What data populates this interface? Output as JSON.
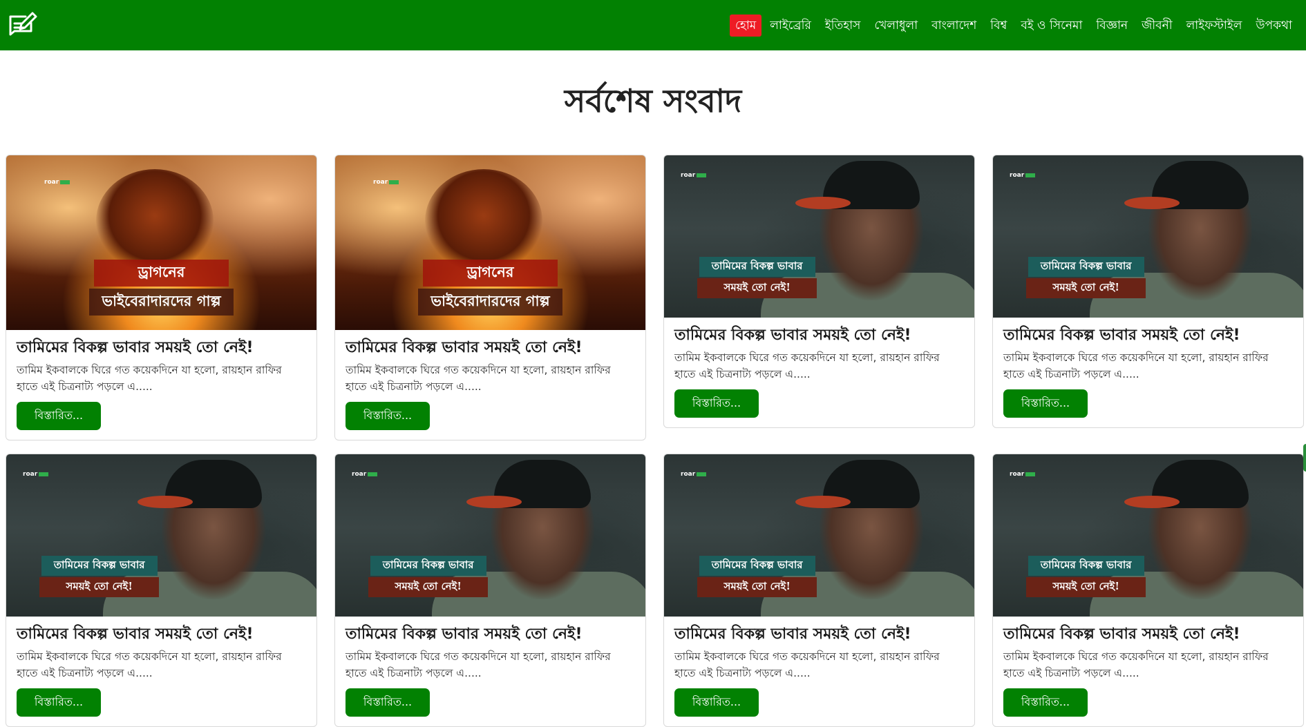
{
  "header": {
    "logo_icon": "edit-note-icon",
    "nav": [
      {
        "label": "হোম",
        "active": true
      },
      {
        "label": "লাইব্রেরি"
      },
      {
        "label": "ইতিহাস"
      },
      {
        "label": "খেলাধুলা"
      },
      {
        "label": "বাংলাদেশ"
      },
      {
        "label": "বিশ্ব"
      },
      {
        "label": "বই ও সিনেমা"
      },
      {
        "label": "বিজ্ঞান"
      },
      {
        "label": "জীবনী"
      },
      {
        "label": "লাইফস্টাইল"
      },
      {
        "label": "উপকথা"
      }
    ],
    "colors": {
      "bar": "#028102",
      "active": "#ee1c25"
    }
  },
  "main": {
    "title": "সর্বশেষ সংবাদ",
    "cards": [
      {
        "image": {
          "kind": "dragon",
          "brand": "roar",
          "lines": [
            "ড্রাগনের",
            "ভাইবেরাদারদের গাল্প"
          ]
        },
        "title": "তামিমের বিকল্প ভাবার সময়ই তো নেই!",
        "excerpt": "তামিম ইকবালকে ঘিরে গত কয়েকদিনে যা হলো, রায়হান রাফির হাতে এই চিত্রনাট্য পড়লে এ.....",
        "button": "বিস্তারিত..."
      },
      {
        "image": {
          "kind": "dragon",
          "brand": "roar",
          "lines": [
            "ড্রাগনের",
            "ভাইবেরাদারদের গাল্প"
          ]
        },
        "title": "তামিমের বিকল্প ভাবার সময়ই তো নেই!",
        "excerpt": "তামিম ইকবালকে ঘিরে গত কয়েকদিনে যা হলো, রায়হান রাফির হাতে এই চিত্রনাট্য পড়লে এ.....",
        "button": "বিস্তারিত..."
      },
      {
        "image": {
          "kind": "person",
          "brand": "roar",
          "lines": [
            "তামিমের বিকল্প ভাবার",
            "সময়ই তো নেই!"
          ]
        },
        "title": "তামিমের বিকল্প ভাবার সময়ই তো নেই!",
        "excerpt": "তামিম ইকবালকে ঘিরে গত কয়েকদিনে যা হলো, রায়হান রাফির হাতে এই চিত্রনাট্য পড়লে এ.....",
        "button": "বিস্তারিত..."
      },
      {
        "image": {
          "kind": "person",
          "brand": "roar",
          "lines": [
            "তামিমের বিকল্প ভাবার",
            "সময়ই তো নেই!"
          ]
        },
        "title": "তামিমের বিকল্প ভাবার সময়ই তো নেই!",
        "excerpt": "তামিম ইকবালকে ঘিরে গত কয়েকদিনে যা হলো, রায়হান রাফির হাতে এই চিত্রনাট্য পড়লে এ.....",
        "button": "বিস্তারিত..."
      },
      {
        "image": {
          "kind": "person",
          "brand": "roar",
          "lines": [
            "তামিমের বিকল্প ভাবার",
            "সময়ই তো নেই!"
          ]
        },
        "title": "তামিমের বিকল্প ভাবার সময়ই তো নেই!",
        "excerpt": "তামিম ইকবালকে ঘিরে গত কয়েকদিনে যা হলো, রায়হান রাফির হাতে এই চিত্রনাট্য পড়লে এ.....",
        "button": "বিস্তারিত..."
      },
      {
        "image": {
          "kind": "person",
          "brand": "roar",
          "lines": [
            "তামিমের বিকল্প ভাবার",
            "সময়ই তো নেই!"
          ]
        },
        "title": "তামিমের বিকল্প ভাবার সময়ই তো নেই!",
        "excerpt": "তামিম ইকবালকে ঘিরে গত কয়েকদিনে যা হলো, রায়হান রাফির হাতে এই চিত্রনাট্য পড়লে এ.....",
        "button": "বিস্তারিত..."
      },
      {
        "image": {
          "kind": "person",
          "brand": "roar",
          "lines": [
            "তামিমের বিকল্প ভাবার",
            "সময়ই তো নেই!"
          ]
        },
        "title": "তামিমের বিকল্প ভাবার সময়ই তো নেই!",
        "excerpt": "তামিম ইকবালকে ঘিরে গত কয়েকদিনে যা হলো, রায়হান রাফির হাতে এই চিত্রনাট্য পড়লে এ.....",
        "button": "বিস্তারিত..."
      },
      {
        "image": {
          "kind": "person",
          "brand": "roar",
          "lines": [
            "তামিমের বিকল্প ভাবার",
            "সময়ই তো নেই!"
          ]
        },
        "title": "তামিমের বিকল্প ভাবার সময়ই তো নেই!",
        "excerpt": "তামিম ইকবালকে ঘিরে গত কয়েকদিনে যা হলো, রায়হান রাফির হাতে এই চিত্রনাট্য পড়লে এ.....",
        "button": "বিস্তারিত..."
      }
    ]
  }
}
